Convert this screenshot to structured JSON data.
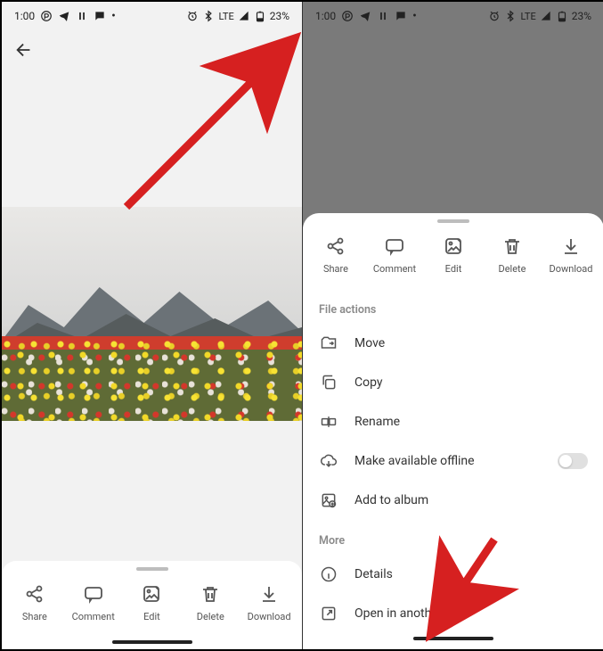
{
  "statusbar": {
    "time": "1:00",
    "network_label": "LTE",
    "battery_text": "23%"
  },
  "actions": {
    "share": "Share",
    "comment": "Comment",
    "edit": "Edit",
    "delete": "Delete",
    "download": "Download"
  },
  "sheet": {
    "section1_label": "File actions",
    "items1": {
      "move": "Move",
      "copy": "Copy",
      "rename": "Rename",
      "offline": "Make available offline",
      "add_album": "Add to album"
    },
    "section2_label": "More",
    "items2": {
      "details": "Details",
      "open_external": "Open in another app"
    }
  }
}
